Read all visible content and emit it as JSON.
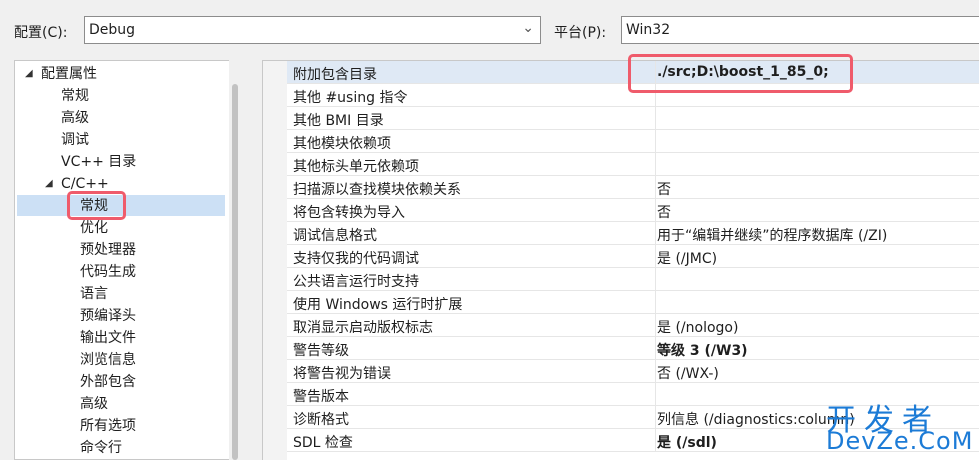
{
  "config": {
    "label": "配置(C):",
    "value": "Debug"
  },
  "platform": {
    "label": "平台(P):",
    "value": "Win32"
  },
  "tree": {
    "root": "配置属性",
    "items": [
      "常规",
      "高级",
      "调试",
      "VC++ 目录"
    ],
    "cpp": "C/C++",
    "cpp_items": [
      "常规",
      "优化",
      "预处理器",
      "代码生成",
      "语言",
      "预编译头",
      "输出文件",
      "浏览信息",
      "外部包含",
      "高级",
      "所有选项",
      "命令行"
    ]
  },
  "rows": [
    {
      "name": "附加包含目录",
      "value": "./src;D:\\boost_1_85_0;",
      "bold": true
    },
    {
      "name": "其他 #using 指令",
      "value": ""
    },
    {
      "name": "其他 BMI 目录",
      "value": ""
    },
    {
      "name": "其他模块依赖项",
      "value": ""
    },
    {
      "name": "其他标头单元依赖项",
      "value": ""
    },
    {
      "name": "扫描源以查找模块依赖关系",
      "value": "否"
    },
    {
      "name": "将包含转换为导入",
      "value": "否"
    },
    {
      "name": "调试信息格式",
      "value": "用于“编辑并继续”的程序数据库 (/ZI)"
    },
    {
      "name": "支持仅我的代码调试",
      "value": "是 (/JMC)"
    },
    {
      "name": "公共语言运行时支持",
      "value": ""
    },
    {
      "name": "使用 Windows 运行时扩展",
      "value": ""
    },
    {
      "name": "取消显示启动版权标志",
      "value": "是 (/nologo)"
    },
    {
      "name": "警告等级",
      "value": "等级 3 (/W3)",
      "bold": true
    },
    {
      "name": "将警告视为错误",
      "value": "否 (/WX-)"
    },
    {
      "name": "警告版本",
      "value": ""
    },
    {
      "name": "诊断格式",
      "value": "列信息 (/diagnostics:column)"
    },
    {
      "name": "SDL 检查",
      "value": "是 (/sdl)",
      "bold": true
    }
  ],
  "watermark": {
    "cn": "开发者",
    "en": "DevZe.CoM"
  },
  "colors": {
    "highlight": "#ef5b6b",
    "selection": "#cce0f5",
    "watermark": "#1c7bd6"
  }
}
